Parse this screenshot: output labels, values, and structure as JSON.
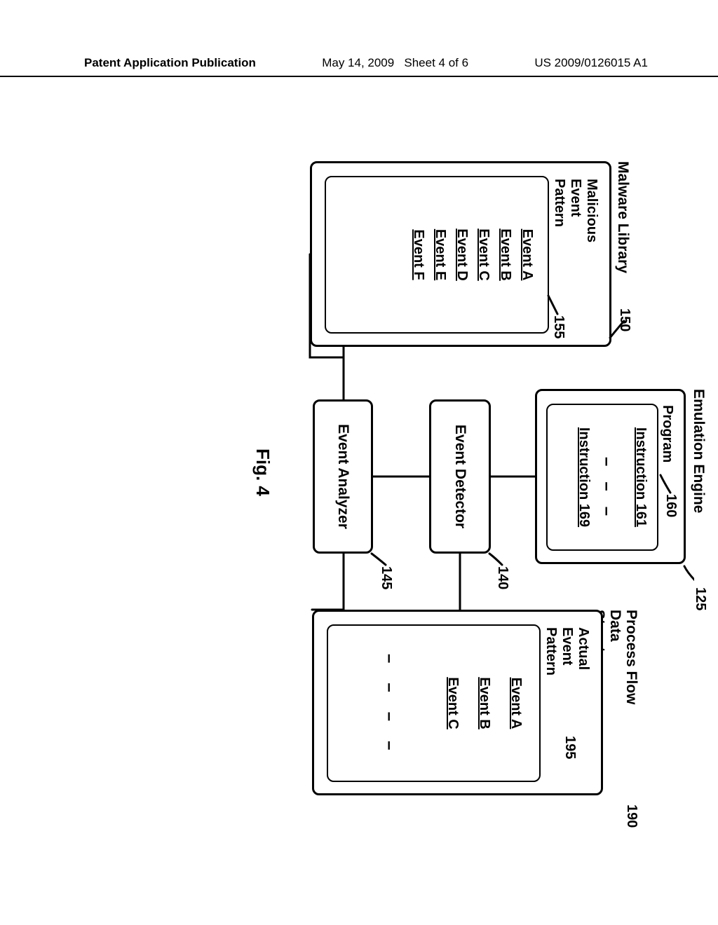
{
  "header": {
    "publication": "Patent Application Publication",
    "date": "May 14, 2009",
    "sheet": "Sheet 4 of 6",
    "docnum": "US 2009/0126015 A1"
  },
  "figure_caption": "Fig. 4",
  "refs": {
    "emulation": "125",
    "program": "160",
    "instr_a": "Instruction 161",
    "instr_b": "Instruction 169",
    "event_detector_num": "140",
    "event_analyzer_num": "145",
    "malware_num": "150",
    "malicious_num": "155",
    "procflow_num": "190",
    "actual_num": "195"
  },
  "blocks": {
    "emulation": "Emulation Engine",
    "program": "Program",
    "event_detector": "Event Detector",
    "event_analyzer": "Event Analyzer",
    "malware_library": "Malware Library",
    "malicious_pattern": "Malicious\nEvent\nPattern",
    "process_flow": "Process Flow\nData Structure",
    "actual_pattern": "Actual\nEvent\nPattern"
  },
  "events_left": [
    "Event A",
    "Event B",
    "Event C",
    "Event D",
    "Event E",
    "Event F"
  ],
  "events_right": [
    "Event A",
    "Event B",
    "Event C"
  ]
}
